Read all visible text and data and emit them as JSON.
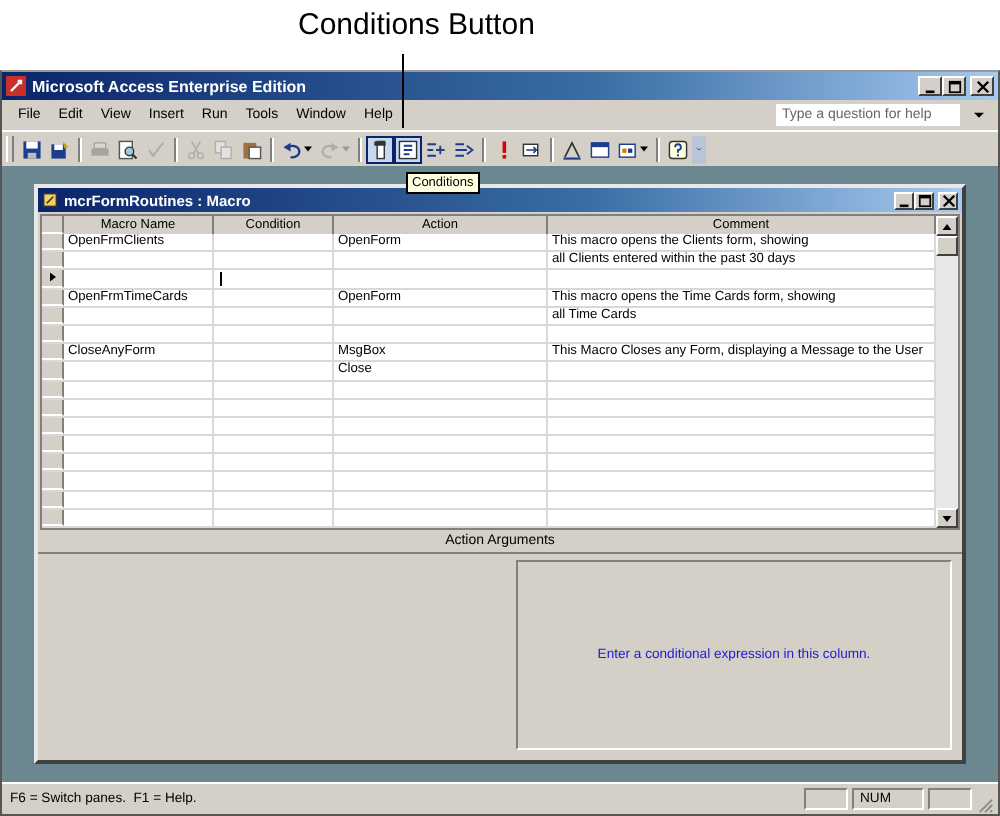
{
  "callout": {
    "label": "Conditions Button"
  },
  "window": {
    "title": "Microsoft Access Enterprise Edition"
  },
  "menu": [
    {
      "label": "File"
    },
    {
      "label": "Edit"
    },
    {
      "label": "View"
    },
    {
      "label": "Insert"
    },
    {
      "label": "Run"
    },
    {
      "label": "Tools"
    },
    {
      "label": "Window"
    },
    {
      "label": "Help"
    }
  ],
  "help_box": {
    "placeholder": "Type a question for help"
  },
  "toolbar": [
    {
      "kind": "save",
      "pressed": false,
      "disabled": false,
      "dropdown": false
    },
    {
      "kind": "save-as",
      "pressed": false,
      "disabled": false,
      "dropdown": false
    },
    {
      "kind": "separator"
    },
    {
      "kind": "print",
      "pressed": false,
      "disabled": true,
      "dropdown": false
    },
    {
      "kind": "preview",
      "pressed": false,
      "disabled": false,
      "dropdown": false
    },
    {
      "kind": "spell",
      "pressed": false,
      "disabled": true,
      "dropdown": false
    },
    {
      "kind": "separator"
    },
    {
      "kind": "cut",
      "pressed": false,
      "disabled": true,
      "dropdown": false
    },
    {
      "kind": "copy",
      "pressed": false,
      "disabled": true,
      "dropdown": false
    },
    {
      "kind": "paste",
      "pressed": false,
      "disabled": false,
      "dropdown": false
    },
    {
      "kind": "separator"
    },
    {
      "kind": "undo",
      "pressed": false,
      "disabled": false,
      "dropdown": true
    },
    {
      "kind": "redo",
      "pressed": false,
      "disabled": true,
      "dropdown": true
    },
    {
      "kind": "separator"
    },
    {
      "kind": "macro-names",
      "pressed": true,
      "disabled": false,
      "dropdown": false
    },
    {
      "kind": "conditions",
      "pressed": true,
      "disabled": false,
      "dropdown": false
    },
    {
      "kind": "insert-rows",
      "pressed": false,
      "disabled": false,
      "dropdown": false
    },
    {
      "kind": "delete-rows",
      "pressed": false,
      "disabled": false,
      "dropdown": false
    },
    {
      "kind": "separator"
    },
    {
      "kind": "run",
      "pressed": false,
      "disabled": false,
      "dropdown": false
    },
    {
      "kind": "single-step",
      "pressed": false,
      "disabled": false,
      "dropdown": false
    },
    {
      "kind": "separator"
    },
    {
      "kind": "build",
      "pressed": false,
      "disabled": false,
      "dropdown": false
    },
    {
      "kind": "database-window",
      "pressed": false,
      "disabled": false,
      "dropdown": false
    },
    {
      "kind": "new-object",
      "pressed": false,
      "disabled": false,
      "dropdown": true
    },
    {
      "kind": "separator"
    },
    {
      "kind": "help",
      "pressed": false,
      "disabled": false,
      "dropdown": false
    },
    {
      "kind": "overflow",
      "pressed": false,
      "disabled": false,
      "dropdown": false
    }
  ],
  "tooltip": {
    "label": "Conditions"
  },
  "macro_window": {
    "title": "mcrFormRoutines : Macro",
    "columns": [
      "Macro Name",
      "Condition",
      "Action",
      "Comment"
    ],
    "rows": [
      {
        "macro_name": "OpenFrmClients",
        "action": "OpenForm",
        "comment": "This macro opens the Clients form, showing",
        "current": false
      },
      {
        "comment": "all Clients entered within the past 30 days",
        "current": false
      },
      {
        "current": true
      },
      {
        "macro_name": "OpenFrmTimeCards",
        "action": "OpenForm",
        "comment": "This macro opens the Time Cards form, showing",
        "current": false
      },
      {
        "comment": "all Time Cards",
        "current": false
      },
      {
        "current": false
      },
      {
        "macro_name": "CloseAnyForm",
        "action": "MsgBox",
        "comment": "This Macro Closes any Form, displaying a Message to the User",
        "current": false
      },
      {
        "action": "Close",
        "current": false
      },
      {
        "current": false
      },
      {
        "current": false
      },
      {
        "current": false
      },
      {
        "current": false
      },
      {
        "current": false
      },
      {
        "current": false
      },
      {
        "current": false
      },
      {
        "current": false
      }
    ]
  },
  "action_arguments": {
    "label": "Action Arguments",
    "hint": "Enter a conditional expression in this column."
  },
  "status_bar": {
    "message": "F6 = Switch panes.  F1 = Help.",
    "indicator": "NUM"
  }
}
